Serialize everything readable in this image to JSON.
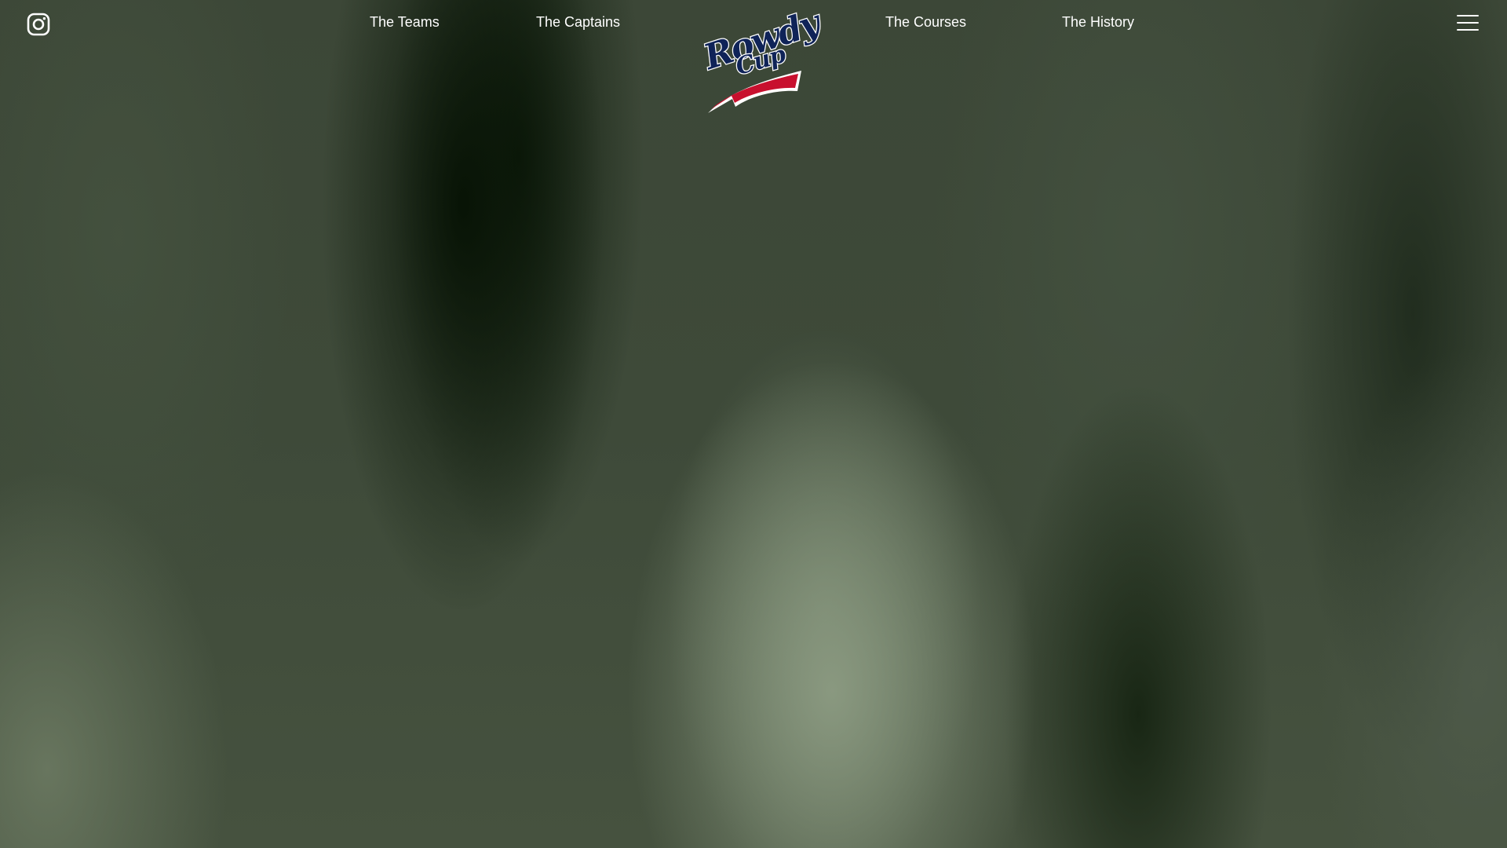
{
  "header": {
    "social": {
      "icon": "instagram-icon"
    },
    "nav": {
      "left": [
        {
          "label": "The Teams"
        },
        {
          "label": "The Captains"
        }
      ],
      "right": [
        {
          "label": "The Courses"
        },
        {
          "label": "The History"
        }
      ]
    },
    "logo": {
      "line1": "Rowdy",
      "line2": "Cup",
      "colors": {
        "navy": "#0f2358",
        "red": "#c8102e",
        "outline": "#ffffff"
      }
    },
    "menu": {
      "icon": "hamburger-menu-icon"
    }
  },
  "theme": {
    "text": "#ffffff",
    "background": "#3b4636"
  }
}
